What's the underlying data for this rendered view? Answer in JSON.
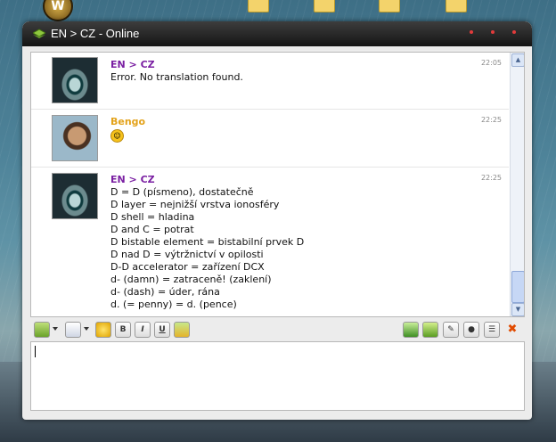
{
  "window": {
    "title": "EN > CZ - Online"
  },
  "messages": [
    {
      "sender": "EN > CZ",
      "sender_color": "#7a1fa2",
      "time": "22:05",
      "lines": [
        "Error. No translation found."
      ],
      "avatar": "eye-avatar"
    },
    {
      "sender": "Bengo",
      "sender_color": "#e3a21a",
      "time": "22:25",
      "emoji": "laughing-emoji-icon",
      "avatar": "person-avatar"
    },
    {
      "sender": "EN > CZ",
      "sender_color": "#7a1fa2",
      "time": "22:25",
      "avatar": "eye-avatar",
      "lines": [
        "D = D (písmeno), dostatečně",
        "D layer = nejnižší vrstva ionosféry",
        "D shell = hladina",
        "D and C = potrat",
        "D bistable element = bistabilní prvek D",
        "D nad D = výtržnictví v opilosti",
        "D-D accelerator = zařízení DCX",
        "d- (damn) = zatraceně! (zaklení)",
        "d- (dash) = úder, rána",
        "d. (= penny) = d. (pence)"
      ]
    }
  ],
  "toolbar": {
    "left": [
      "contact-icon",
      "card-icon",
      "emoticon-icon",
      "bold-icon",
      "italic-icon",
      "underline-icon",
      "nudge-icon"
    ],
    "bold_label": "B",
    "italic_label": "I",
    "underline_label": "U",
    "right": [
      "photo-icon",
      "send-file-icon",
      "edit-icon",
      "chat-bubble-icon",
      "list-icon",
      "close-icon"
    ]
  },
  "input": {
    "value": ""
  },
  "colors": {
    "accent": "#7a1fa2",
    "secondary": "#e3a21a"
  }
}
